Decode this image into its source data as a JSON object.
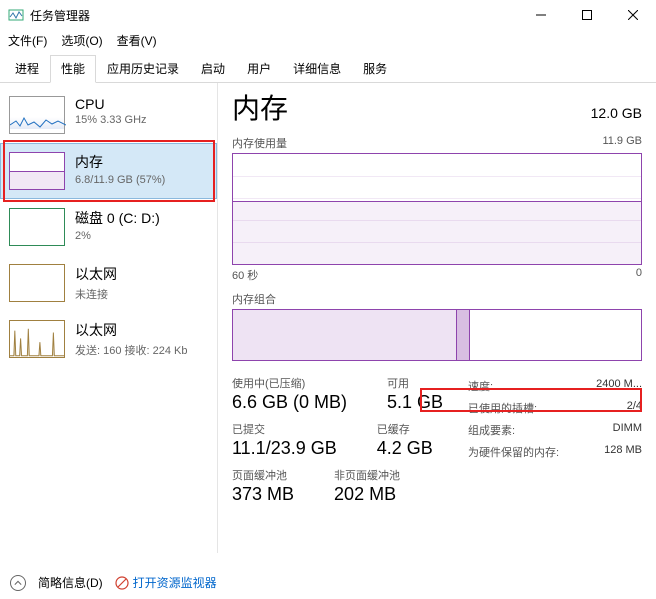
{
  "window": {
    "title": "任务管理器"
  },
  "menu": {
    "file": "文件(F)",
    "options": "选项(O)",
    "view": "查看(V)"
  },
  "tabs": {
    "processes": "进程",
    "performance": "性能",
    "appHistory": "应用历史记录",
    "startup": "启动",
    "users": "用户",
    "details": "详细信息",
    "services": "服务"
  },
  "sidebar": {
    "items": [
      {
        "name": "CPU",
        "sub": "15% 3.33 GHz"
      },
      {
        "name": "内存",
        "sub": "6.8/11.9 GB (57%)"
      },
      {
        "name": "磁盘 0 (C: D:)",
        "sub": "2%"
      },
      {
        "name": "以太网",
        "sub": "未连接"
      },
      {
        "name": "以太网",
        "sub": "发送: 160 接收: 224 Kb"
      }
    ]
  },
  "main": {
    "title": "内存",
    "total": "12.0 GB",
    "usageLabel": "内存使用量",
    "usageMax": "11.9 GB",
    "timeLabel": "60 秒",
    "timeZero": "0",
    "compLabel": "内存组合",
    "stats": {
      "inUseLabel": "使用中(已压缩)",
      "inUseValue": "6.6 GB (0 MB)",
      "availLabel": "可用",
      "availValue": "5.1 GB",
      "committedLabel": "已提交",
      "committedValue": "11.1/23.9 GB",
      "cachedLabel": "已缓存",
      "cachedValue": "4.2 GB",
      "pagedLabel": "页面缓冲池",
      "pagedValue": "373 MB",
      "nonpagedLabel": "非页面缓冲池",
      "nonpagedValue": "202 MB"
    },
    "specs": {
      "speedLabel": "速度:",
      "speedValue": "2400 M...",
      "slotsLabel": "已使用的插槽:",
      "slotsValue": "2/4",
      "formLabel": "组成要素:",
      "formValue": "DIMM",
      "reservedLabel": "为硬件保留的内存:",
      "reservedValue": "128 MB"
    }
  },
  "footer": {
    "fewer": "简略信息(D)",
    "resmon": "打开资源监视器"
  }
}
